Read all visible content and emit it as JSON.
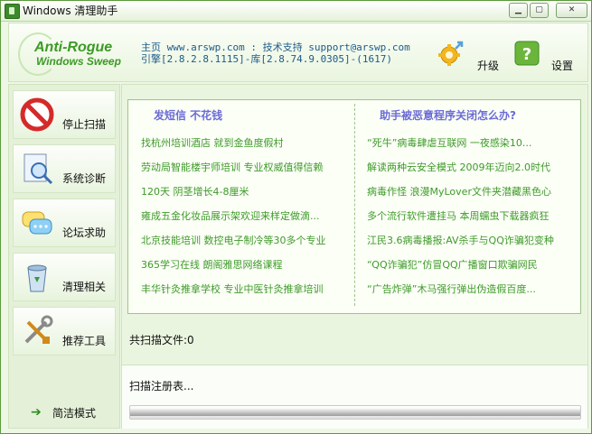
{
  "window": {
    "title": "Windows 清理助手"
  },
  "header": {
    "logo_line1": "Anti-Rogue",
    "logo_line2": "Windows Sweep",
    "info_line1": "主页 www.arswp.com : 技术支持 support@arswp.com",
    "info_line2": "引擎[2.8.2.8.1115]-库[2.8.74.9.0305]-(1617)",
    "upgrade_label": "升级",
    "settings_label": "设置"
  },
  "sidebar": {
    "items": [
      {
        "label": "停止扫描",
        "icon": "stop-scan-icon"
      },
      {
        "label": "系统诊断",
        "icon": "diagnose-icon"
      },
      {
        "label": "论坛求助",
        "icon": "forum-icon"
      },
      {
        "label": "清理相关",
        "icon": "recycle-bin-icon"
      },
      {
        "label": "推荐工具",
        "icon": "tools-icon"
      }
    ],
    "simple_mode_label": "简洁模式"
  },
  "ads": {
    "left_header": "发短信 不花钱",
    "right_header": "助手被恶意程序关闭怎么办?",
    "left_links": [
      "找杭州培训酒店 就到金鱼度假村",
      "劳动局智能楼宇师培训 专业权威值得信赖",
      "120天 阴茎增长4-8厘米",
      "雍成五金化妆品展示架欢迎来样定做滴...",
      "北京技能培训 数控电子制冷等30多个专业",
      "365学习在线 朗阁雅思网络课程",
      "丰华针灸推拿学校 专业中医针灸推拿培训"
    ],
    "right_links": [
      "“死牛”病毒肆虐互联网 一夜感染10...",
      "解读两种云安全模式 2009年迈向2.0时代",
      "病毒作怪 浪漫MyLover文件夹潜藏黑色心",
      "多个流行软件遭挂马 本周蠕虫下载器疯狂",
      "江民3.6病毒播报:AV杀手与QQ诈骗犯变种",
      "“QQ诈骗犯”仿冒QQ广播窗口欺骗网民",
      "“广告炸弹”木马强行弹出伪造假百度..."
    ]
  },
  "scan": {
    "count_text": "共扫描文件:0",
    "status_text": "扫描注册表...",
    "progress": 1.0
  }
}
